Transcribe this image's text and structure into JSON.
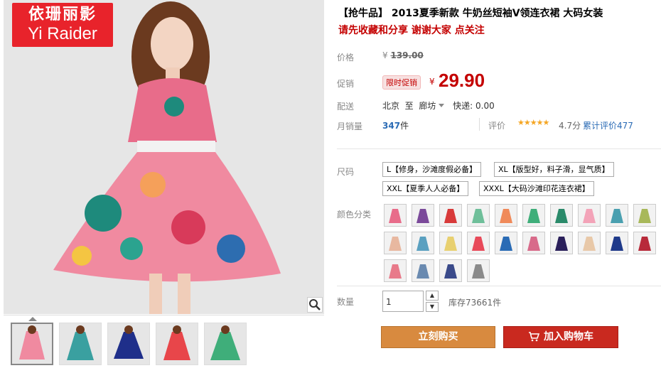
{
  "brand": {
    "logo_cn": "依珊丽影",
    "logo_en": "Yi Raider"
  },
  "product": {
    "title": "【抢牛品】 2013夏季新款 牛奶丝短袖V领连衣裙 大码女装",
    "subtitle": "请先收藏和分享 谢谢大家 点关注"
  },
  "price": {
    "label": "价格",
    "currency": "¥",
    "original": "139.00"
  },
  "promo": {
    "label": "促销",
    "tag": "限时促销",
    "currency": "¥",
    "price": "29.90"
  },
  "shipping": {
    "label": "配送",
    "from": "北京",
    "to_word": "至",
    "destination": "廊坊",
    "fee_text": "快递: 0.00"
  },
  "sales": {
    "label": "月销量",
    "count": "347",
    "unit": "件"
  },
  "rating": {
    "label": "评价",
    "stars": "★★★★★",
    "score": "4.7分",
    "review_count": "累计评价477",
    "star_color": "#f5a623"
  },
  "size": {
    "label": "尺码",
    "options": [
      "L【修身，沙滩度假必备】",
      "XL【版型好，料子滑，显气质】",
      "XXL【夏季人人必备】",
      "XXXL【大码沙滩印花连衣裙】"
    ]
  },
  "color": {
    "label": "颜色分类"
  },
  "quantity": {
    "label": "数量",
    "value": "1",
    "up": "▲",
    "down": "▼",
    "stock": "库存73661件"
  },
  "actions": {
    "buy_now": "立刻购买",
    "add_to_cart": "加入购物车",
    "buy_color": "#d88a3f",
    "cart_color": "#c9291f"
  },
  "accent_color": "#c40000"
}
